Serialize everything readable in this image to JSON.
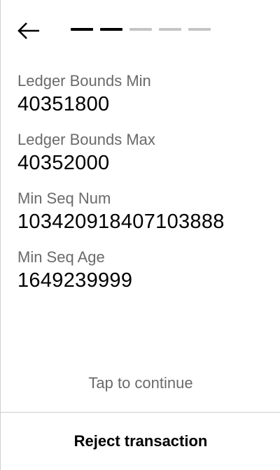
{
  "header": {
    "back_icon": "arrow-left-icon",
    "progress": {
      "total_steps": 5,
      "completed_steps": 2,
      "active_color": "#000000",
      "inactive_color": "#c4c4c4"
    }
  },
  "fields": [
    {
      "label": "Ledger Bounds Min",
      "value": "40351800"
    },
    {
      "label": "Ledger Bounds Max",
      "value": "40352000"
    },
    {
      "label": "Min Seq Num",
      "value": "103420918407103888"
    },
    {
      "label": "Min Seq Age",
      "value": "1649239999"
    }
  ],
  "footer": {
    "tap_hint": "Tap to continue",
    "reject_label": "Reject transaction"
  }
}
